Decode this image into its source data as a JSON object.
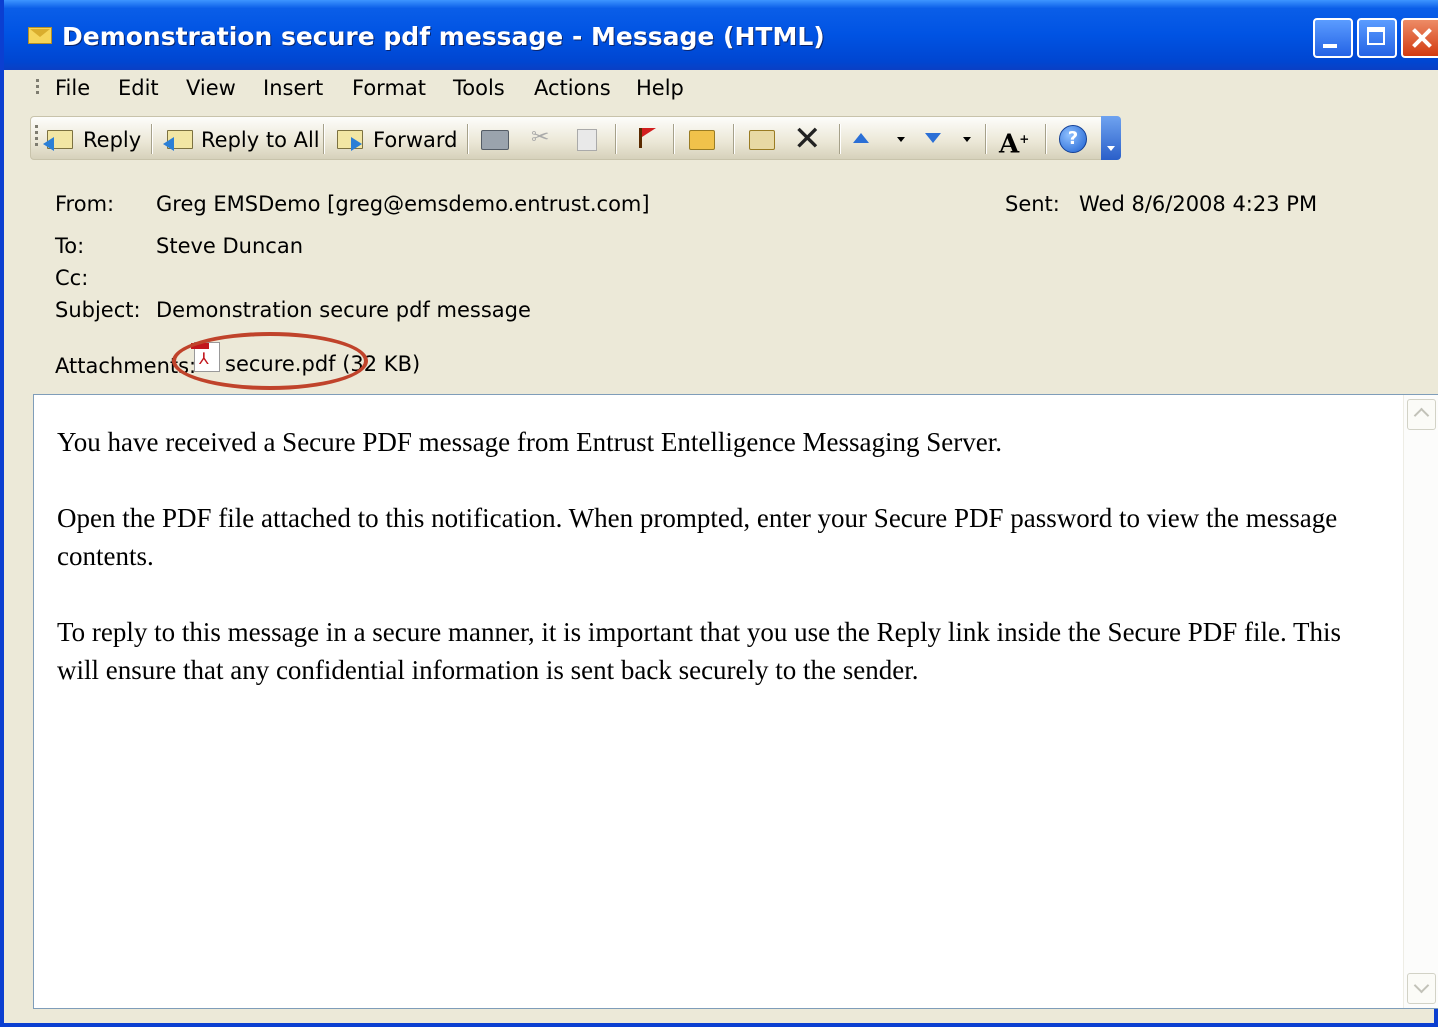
{
  "window": {
    "title": "Demonstration secure pdf message - Message (HTML)",
    "icon": "envelope-icon"
  },
  "menu": {
    "items": [
      "File",
      "Edit",
      "View",
      "Insert",
      "Format",
      "Tools",
      "Actions",
      "Help"
    ]
  },
  "toolbar": {
    "reply_label": "Reply",
    "reply_all_label": "Reply to All",
    "forward_label": "Forward",
    "icons": [
      "reply-icon",
      "reply-all-icon",
      "forward-icon",
      "print-icon",
      "cut-icon",
      "copy-icon",
      "flag-icon",
      "move-to-folder-icon",
      "paste-icon",
      "delete-icon",
      "previous-item-icon",
      "next-item-icon",
      "font-size-icon",
      "help-icon"
    ]
  },
  "header": {
    "from_label": "From:",
    "from_value": "Greg EMSDemo [greg@emsdemo.entrust.com]",
    "sent_label": "Sent:",
    "sent_value": "Wed 8/6/2008 4:23 PM",
    "to_label": "To:",
    "to_value": "Steve Duncan",
    "cc_label": "Cc:",
    "cc_value": "",
    "subject_label": "Subject:",
    "subject_value": "Demonstration secure pdf message",
    "attachments_label": "Attachments:",
    "attachment_name": "secure.pdf (32 KB)",
    "highlight_color": "#c0432b"
  },
  "body": {
    "paragraphs": [
      "You have received a Secure PDF message from Entrust Entelligence Messaging Server.",
      "Open the PDF file attached to this notification. When prompted, enter your Secure PDF password to view the message contents.",
      "To reply to this message in a secure manner, it is important that you use the Reply link inside the Secure PDF file. This will ensure that any confidential information is sent back securely to the sender."
    ]
  },
  "colors": {
    "titlebar": "#0053e3",
    "chrome": "#ece9d8",
    "close_button": "#d23b11"
  }
}
